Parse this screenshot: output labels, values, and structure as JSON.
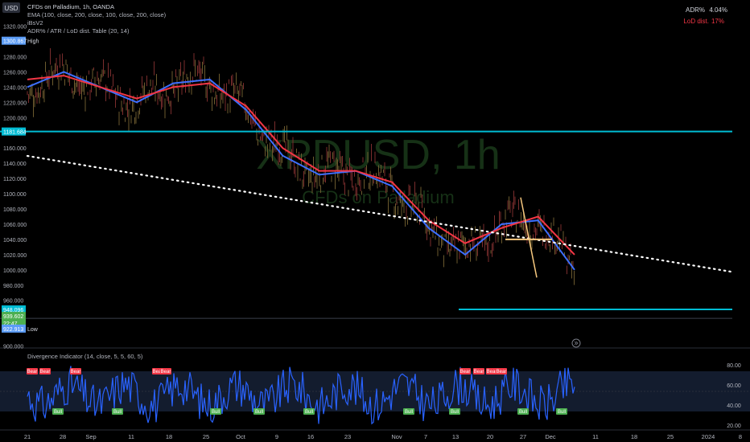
{
  "header": {
    "currency_badge": "USD",
    "legend_lines": [
      "CFDs on Palladium, 1h, OANDA",
      "EMA (100, close, 200, close, 100, close, 200, close)",
      "iBsV2",
      "ADR% / ATR / LoD dist. Table (20, 14)"
    ]
  },
  "stats_table": {
    "rows": [
      {
        "label": "ADR%",
        "value": "4.04%"
      },
      {
        "label": "LoD dist.",
        "value": "17%"
      }
    ]
  },
  "watermark": {
    "symbol": "XPDUSD, 1h",
    "name": "CFDs on Palladium"
  },
  "price_axis": {
    "ticks": [
      "1320.000",
      "1280.000",
      "1260.000",
      "1240.000",
      "1220.000",
      "1200.000",
      "1160.000",
      "1140.000",
      "1120.000",
      "1100.000",
      "1080.000",
      "1060.000",
      "1040.000",
      "1020.000",
      "1000.000",
      "980.000",
      "960.000",
      "900.000"
    ],
    "labels": [
      {
        "text": "1300.867",
        "tag": "High",
        "color": "#5b9cf6"
      },
      {
        "text": "1181.684",
        "tag": "",
        "color": "#00bcd4"
      },
      {
        "text": "948.096",
        "tag": "",
        "color": "#00bcd4"
      },
      {
        "text": "939.602",
        "tag": "",
        "color": "#4caf50"
      },
      {
        "text": "22:47",
        "tag": "",
        "color": "#4caf50"
      },
      {
        "text": "922.913",
        "tag": "Low",
        "color": "#5b9cf6"
      }
    ]
  },
  "indicator": {
    "title": "Divergence Indicator (14, close, 5, 5, 60, 5)",
    "ticks": [
      "80.00",
      "60.00",
      "40.00",
      "20.00"
    ],
    "bear_label": "Bear",
    "bull_label": "Bull"
  },
  "time_axis": {
    "labels": [
      "21",
      "28",
      "Sep",
      "11",
      "18",
      "25",
      "Oct",
      "9",
      "16",
      "23",
      "Nov",
      "7",
      "13",
      "20",
      "27",
      "Dec",
      "11",
      "18",
      "25",
      "2024",
      "8"
    ]
  },
  "colors": {
    "price_line": "#00bcd4",
    "ema_fast": "#3d6fff",
    "ema_slow": "#f23645",
    "trend_dotted": "#ffffff",
    "rsi": "#2962ff",
    "bull": "#4caf50",
    "bear": "#f23645",
    "cross": "#f5c77e"
  },
  "chart_data": {
    "type": "line",
    "symbol": "XPDUSD",
    "interval": "1h",
    "ylim": [
      900,
      1320
    ],
    "x": [
      "21",
      "28",
      "Sep",
      "11",
      "18",
      "25",
      "Oct",
      "9",
      "16",
      "23",
      "Nov",
      "7",
      "13",
      "20",
      "27",
      "Dec"
    ],
    "series": [
      {
        "name": "EMA 100",
        "values": [
          1240,
          1260,
          1240,
          1220,
          1245,
          1250,
          1210,
          1150,
          1125,
          1130,
          1110,
          1055,
          1020,
          1060,
          1065,
          1000
        ]
      },
      {
        "name": "EMA 200",
        "values": [
          1250,
          1255,
          1240,
          1225,
          1240,
          1245,
          1215,
          1160,
          1130,
          1130,
          1115,
          1065,
          1035,
          1055,
          1070,
          1020
        ]
      }
    ],
    "horizontal_levels": [
      1181.684,
      948.096
    ],
    "last_price": 939.602,
    "high": 1300.867,
    "low": 922.913,
    "stats": {
      "adr_pct": "4.04%",
      "lod_dist": "17%"
    },
    "oscillator": {
      "ylim": [
        15,
        85
      ],
      "levels": [
        80,
        60,
        40,
        20
      ]
    }
  }
}
